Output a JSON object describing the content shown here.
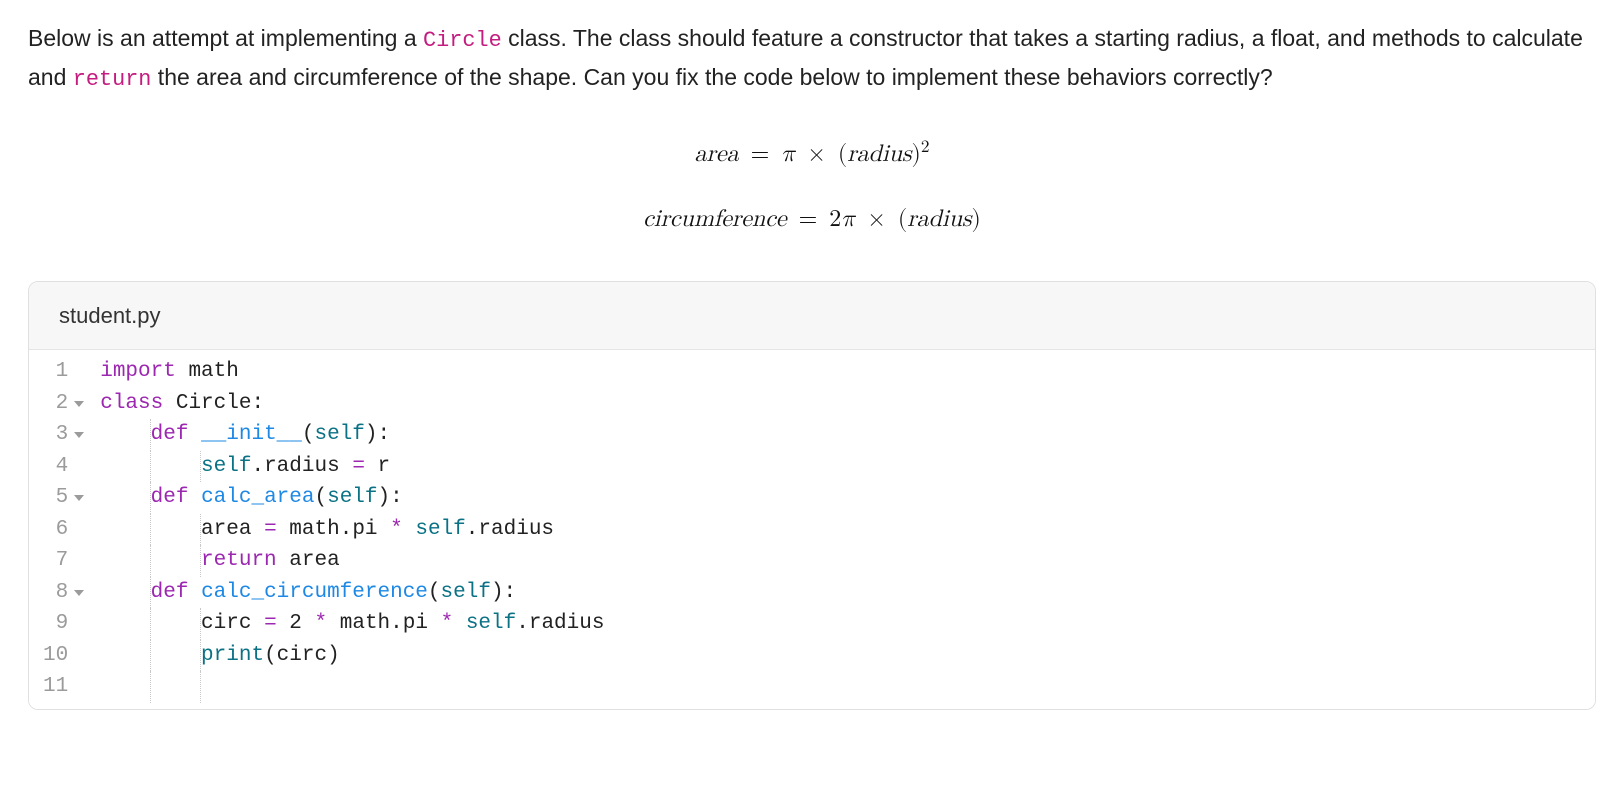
{
  "prose": {
    "part1": "Below is an attempt at implementing a ",
    "code1": "Circle",
    "part2": " class. The class should feature a constructor that takes a starting radius, a float, and methods to calculate and ",
    "code2": "return",
    "part3": " the area and circumference of the shape. Can you fix the code below to implement these behaviors correctly?"
  },
  "formulas": {
    "area": {
      "lhs": "area",
      "eq": "=",
      "pi": "π",
      "times": "×",
      "open": "(",
      "rad": "radius",
      "close": ")",
      "exp": "2"
    },
    "circ": {
      "lhs": "circumference",
      "eq": "=",
      "two": "2",
      "pi": "π",
      "times": "×",
      "open": "(",
      "rad": "radius",
      "close": ")"
    }
  },
  "editor": {
    "filename": "student.py",
    "lines": [
      {
        "n": "1",
        "fold": false
      },
      {
        "n": "2",
        "fold": true
      },
      {
        "n": "3",
        "fold": true
      },
      {
        "n": "4",
        "fold": false
      },
      {
        "n": "5",
        "fold": true
      },
      {
        "n": "6",
        "fold": false
      },
      {
        "n": "7",
        "fold": false
      },
      {
        "n": "8",
        "fold": true
      },
      {
        "n": "9",
        "fold": false
      },
      {
        "n": "10",
        "fold": false
      },
      {
        "n": "11",
        "fold": false
      }
    ],
    "code": {
      "l1": {
        "kw": "import",
        "sp": " ",
        "name": "math"
      },
      "l2": {
        "kw": "class",
        "sp": " ",
        "name": "Circle",
        "colon": ":"
      },
      "l3": {
        "indent": "    ",
        "kw": "def",
        "sp": " ",
        "fn": "__init__",
        "open": "(",
        "self": "self",
        "close": "):"
      },
      "l4": {
        "indent": "        ",
        "self": "self",
        "dot": ".",
        "attr": "radius",
        "sp": " ",
        "op": "=",
        "sp2": " ",
        "var": "r"
      },
      "l5": {
        "indent": "    ",
        "kw": "def",
        "sp": " ",
        "fn": "calc_area",
        "open": "(",
        "self": "self",
        "close": "):"
      },
      "l6": {
        "indent": "        ",
        "var": "area",
        "sp": " ",
        "op": "=",
        "sp2": " ",
        "mod": "math",
        "dot": ".",
        "attr": "pi",
        "sp3": " ",
        "op2": "*",
        "sp4": " ",
        "self": "self",
        "dot2": ".",
        "attr2": "radius"
      },
      "l7": {
        "indent": "        ",
        "kw": "return",
        "sp": " ",
        "var": "area"
      },
      "l8": {
        "indent": "    ",
        "kw": "def",
        "sp": " ",
        "fn": "calc_circumference",
        "open": "(",
        "self": "self",
        "close": "):"
      },
      "l9": {
        "indent": "        ",
        "var": "circ",
        "sp": " ",
        "op": "=",
        "sp2": " ",
        "num": "2",
        "sp3": " ",
        "op2": "*",
        "sp4": " ",
        "mod": "math",
        "dot": ".",
        "attr": "pi",
        "sp5": " ",
        "op3": "*",
        "sp6": " ",
        "self": "self",
        "dot2": ".",
        "attr2": "radius"
      },
      "l10": {
        "indent": "        ",
        "fn": "print",
        "open": "(",
        "arg": "circ",
        "close": ")"
      },
      "l11": {
        "indent": "        "
      }
    }
  }
}
